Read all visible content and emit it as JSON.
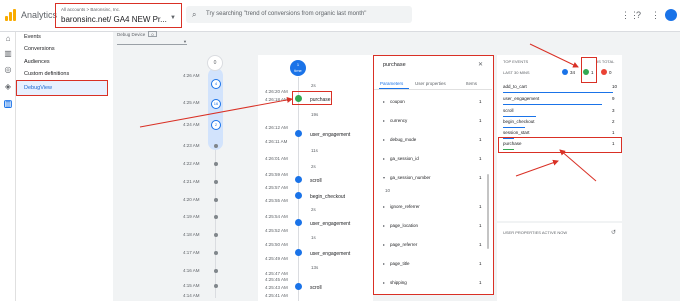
{
  "app": {
    "name": "Analytics"
  },
  "account": {
    "crumb": "All accounts > Baronsinc, Inc.",
    "property": "baronsinc.net/ GA4 NEW Pr..."
  },
  "search": {
    "placeholder": "Try searching \"trend of conversions from organic last month\""
  },
  "topbar_icons": [
    "apps-icon",
    "help-icon",
    "more-vert-icon"
  ],
  "rail_icons": [
    "home-icon",
    "reports-icon",
    "explore-icon",
    "advertising-icon",
    "configure-icon"
  ],
  "nav": {
    "items": [
      "Events",
      "Conversions",
      "Audiences",
      "Custom definitions"
    ],
    "active": "DebugView"
  },
  "device": {
    "label": "Debug Device",
    "count": "0"
  },
  "minutes": {
    "top_count": "0",
    "times": [
      "4:26 AM",
      "4:25 AM",
      "4:24 AM",
      "4:23 AM",
      "4:22 AM",
      "4:21 AM",
      "4:20 AM",
      "4:19 AM",
      "4:18 AM",
      "4:17 AM",
      "4:16 AM",
      "4:15 AM",
      "4:14 AM",
      "4:13 AM"
    ],
    "counts": [
      "4",
      "16",
      "2"
    ]
  },
  "seconds": {
    "badge_count": "1",
    "badge_unit": "time",
    "times": [
      "4:26:20 AM",
      "4:26:18 AM",
      "4:26:12 AM",
      "4:26:11 AM",
      "4:26:01 AM",
      "4:25:59 AM",
      "4:25:57 AM",
      "4:25:55 AM",
      "4:25:54 AM",
      "4:25:52 AM",
      "4:25:50 AM",
      "4:25:49 AM",
      "4:25:47 AM",
      "4:25:45 AM",
      "4:25:43 AM",
      "4:25:41 AM"
    ],
    "gaps": [
      "2s",
      "19s",
      "11s",
      "2s",
      "2s",
      "1s",
      "13s"
    ],
    "events": [
      "purchase",
      "user_engagement",
      "scroll",
      "begin_checkout",
      "user_engagement",
      "user_engagement",
      "scroll"
    ]
  },
  "detail": {
    "title": "purchase",
    "tabs": [
      "Parameters",
      "User properties",
      "Items"
    ],
    "rows": [
      {
        "name": "coupon",
        "count": "1"
      },
      {
        "name": "currency",
        "count": "1"
      },
      {
        "name": "debug_mode",
        "count": "1"
      },
      {
        "name": "ga_session_id",
        "count": "1"
      },
      {
        "name": "ga_session_number",
        "count": "1"
      },
      {
        "name": "ignore_referrer",
        "count": "1"
      },
      {
        "name": "page_location",
        "count": "1"
      },
      {
        "name": "page_referrer",
        "count": "1"
      },
      {
        "name": "page_title",
        "count": "1"
      },
      {
        "name": "shipping",
        "count": "1"
      }
    ],
    "expanded_value": "10"
  },
  "top_events": {
    "title": "TOP EVENTS",
    "total_label": "IS TOTAL",
    "last_label": "LAST 30 MINS",
    "counts": [
      "34",
      "1",
      "0"
    ],
    "events": [
      {
        "name": "add_to_cart",
        "count": "10"
      },
      {
        "name": "user_engagement",
        "count": "9"
      },
      {
        "name": "scroll",
        "count": "3"
      },
      {
        "name": "begin_checkout",
        "count": "2"
      },
      {
        "name": "session_start",
        "count": "1"
      },
      {
        "name": "purchase",
        "count": "1"
      }
    ]
  },
  "user_properties": {
    "title": "USER PROPERTIES ACTIVE NOW"
  },
  "colors": {
    "accent": "#1a73e8",
    "annotation": "#d93025",
    "conversion": "#34a853",
    "error": "#ea4335"
  }
}
